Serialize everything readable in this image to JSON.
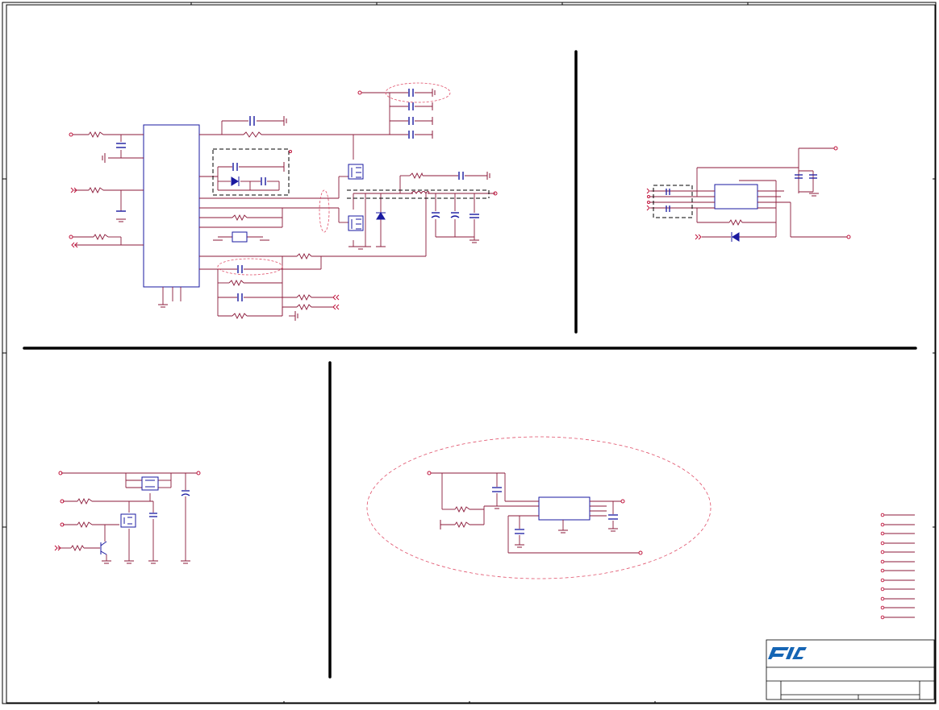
{
  "title_block": {
    "logo": "FIC"
  },
  "colors": {
    "wire": "#8b1a3a",
    "component": "#1a1aa0",
    "pin": "#c0143c",
    "frame": "#000000",
    "region_outline": "#e0506a",
    "logo": "#1565b4"
  },
  "icons": [
    "ground-icon",
    "capacitor-icon",
    "resistor-icon",
    "diode-icon",
    "mosfet-icon",
    "transistor-icon",
    "inductor-icon",
    "offpage-connector-icon",
    "logo-mark"
  ]
}
